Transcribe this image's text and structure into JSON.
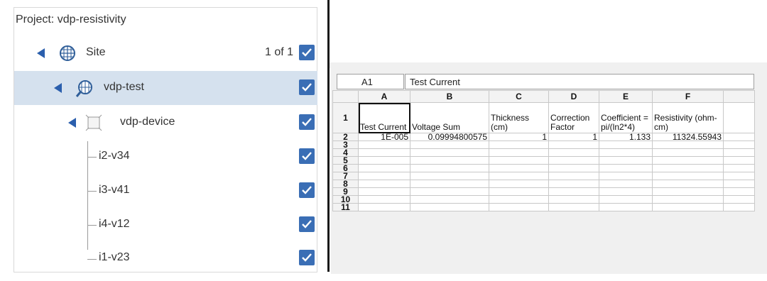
{
  "tree": {
    "project_title": "Project: vdp-resistivity",
    "nodes": [
      {
        "label": "Site",
        "count": "1 of 1",
        "icon": "globe-grid-icon"
      },
      {
        "label": "vdp-test",
        "icon": "test-globe-icon"
      },
      {
        "label": "vdp-device",
        "icon": "device-icon"
      },
      {
        "label": "i2-v34"
      },
      {
        "label": "i3-v41"
      },
      {
        "label": "i4-v12"
      },
      {
        "label": "i1-v23"
      }
    ]
  },
  "sheet": {
    "cell_ref": "A1",
    "formula": "Test Current",
    "columns": [
      "A",
      "B",
      "C",
      "D",
      "E",
      "F",
      ""
    ],
    "rows": [
      "1",
      "2",
      "3",
      "4",
      "5",
      "6",
      "7",
      "8",
      "9",
      "10",
      "11"
    ],
    "r1": [
      "Test Current",
      "Voltage Sum",
      "Thickness (cm)",
      "Correction Factor",
      "Coefficient = pi/(ln2*4)",
      "Resistivity (ohm-cm)",
      ""
    ],
    "r2": [
      "1E-005",
      "0.09994800575",
      "1",
      "1",
      "1.133",
      "11324.55943",
      ""
    ]
  },
  "colors": {
    "accent": "#3a6eb5",
    "selected_row": "#d5e1ee"
  }
}
